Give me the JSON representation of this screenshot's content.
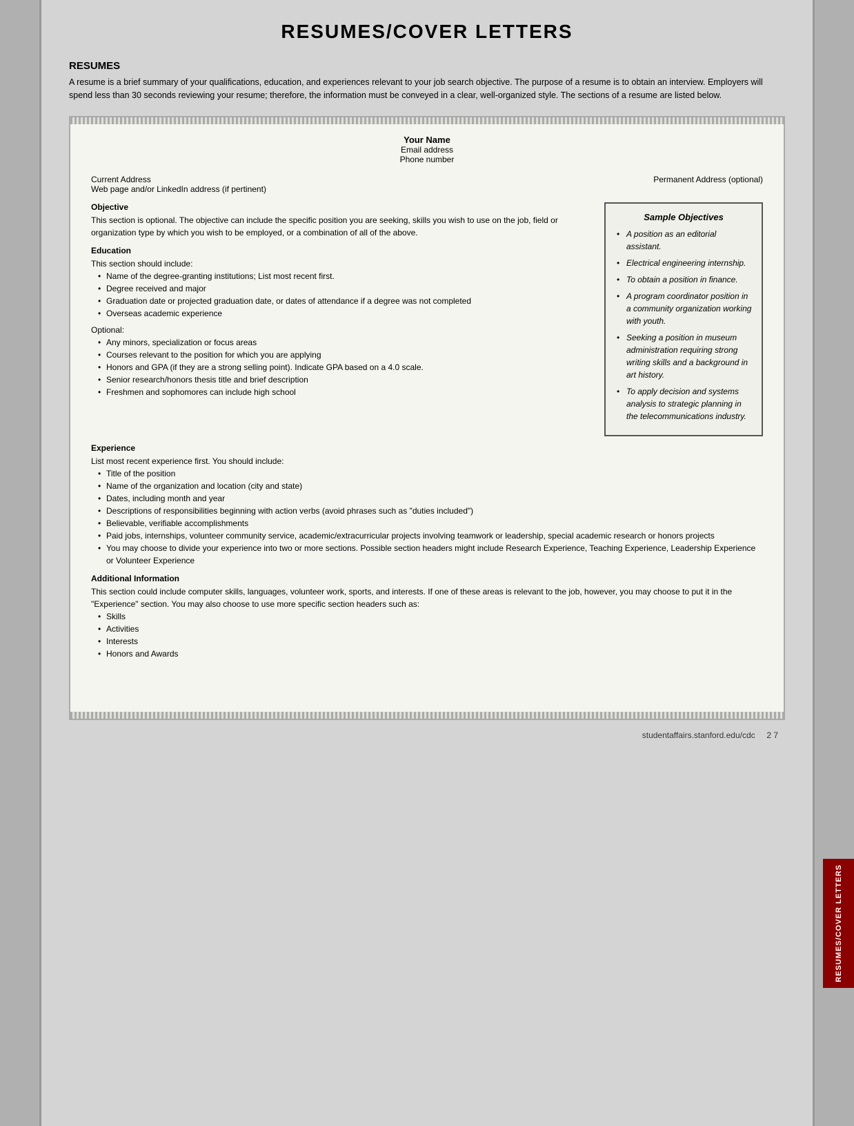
{
  "page": {
    "title": "RESUMES/COVER LETTERS",
    "footer_url": "studentaffairs.stanford.edu/cdc",
    "footer_page": "2 7",
    "vertical_label": "RESUMES/COVER LETTERS"
  },
  "resumes_section": {
    "heading": "RESUMES",
    "intro": "A resume is a brief summary of your qualifications, education, and experiences relevant to your job search objective. The purpose of a resume is to obtain an interview. Employers will spend less than 30 seconds reviewing your resume; therefore, the information must be conveyed in a clear, well-organized style. The sections of a resume are listed below."
  },
  "resume_template": {
    "name": "Your Name",
    "email": "Email address",
    "phone": "Phone number",
    "current_address": "Current Address",
    "web_address": "Web page and/or LinkedIn address (if pertinent)",
    "permanent_address": "Permanent Address (optional)",
    "objective_title": "Objective",
    "objective_text": "This section is optional. The objective can include the specific position you are seeking, skills you wish to use on the job, field or organization type by which you wish to be employed, or a combination of all of the above.",
    "education_title": "Education",
    "education_intro": "This section should include:",
    "education_bullets": [
      "Name of the degree-granting institutions; List most recent first.",
      "Degree received and major",
      "Graduation date or projected graduation date, or dates of attendance if a degree was not completed",
      "Overseas academic experience"
    ],
    "education_optional_label": "Optional:",
    "education_optional_bullets": [
      "Any minors, specialization or focus areas",
      "Courses relevant to the position for which you are applying",
      "Honors and GPA (if they are a strong selling point). Indicate GPA based on a 4.0 scale.",
      "Senior research/honors thesis title and brief description",
      "Freshmen and sophomores can include high school"
    ],
    "experience_title": "Experience",
    "experience_intro": "List most recent experience first. You should include:",
    "experience_bullets": [
      "Title of the position",
      "Name of the organization and location (city and state)",
      "Dates, including month and year",
      "Descriptions of responsibilities beginning with action verbs (avoid phrases such as \"duties included\")",
      "Believable, verifiable accomplishments",
      "Paid jobs, internships, volunteer community service, academic/extracurricular projects involving teamwork or leadership, special academic research or honors projects",
      "You may choose to divide your experience into two or more sections. Possible section headers might include Research Experience, Teaching Experience, Leadership Experience or Volunteer Experience"
    ],
    "additional_title": "Additional Information",
    "additional_text": "This section could include computer skills, languages, volunteer work, sports, and interests. If one of these areas is relevant to the job, however, you may choose to put it in the \"Experience\" section. You may also choose to use more specific section headers such as:",
    "additional_bullets": [
      "Skills",
      "Activities",
      "Interests",
      "Honors and Awards"
    ]
  },
  "sample_objectives": {
    "title": "Sample Objectives",
    "items": [
      "A position as an editorial assistant.",
      "Electrical engineering internship.",
      "To obtain a position in finance.",
      "A program coordinator position in a community organization working with youth.",
      "Seeking a position in museum administration requiring strong writing skills and a background in art history.",
      "To apply decision and systems analysis to strategic planning in the telecommunications industry."
    ]
  }
}
